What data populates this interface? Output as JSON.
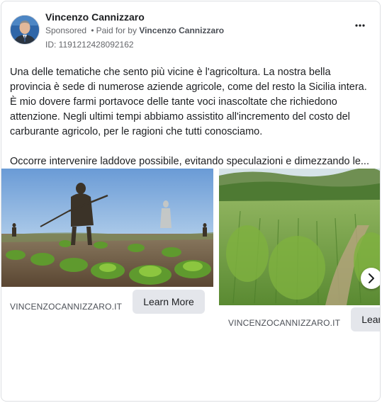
{
  "post": {
    "author_name": "Vincenzo Cannizzaro",
    "sponsored_label": "Sponsored",
    "separator": "•",
    "paid_for_prefix": "Paid for by",
    "paid_for_name": "Vincenzo Cannizzaro",
    "ad_id": "ID: 1191212428092162",
    "more_icon": "more-horizontal-icon",
    "paragraph_1": "Una delle tematiche che sento più vicine è l'agricoltura. La nostra bella provincia è sede di numerose aziende agricole, come del resto la Sicilia intera. È mio dovere farmi portavoce delle tante voci inascoltate che richiedono attenzione. Negli ultimi tempi abbiamo assistito all'incremento del costo del carburante agricolo, per le ragioni che tutti conosciamo.",
    "paragraph_2": "Occorre intervenire laddove possibile, evitando speculazioni e dimezzando le..."
  },
  "carousel": {
    "cards": [
      {
        "domain": "VINCENZOCANNIZZARO.IT",
        "cta_label": "Learn More"
      },
      {
        "domain": "VINCENZOCANNIZZARO.IT",
        "cta_label": "Learn More"
      }
    ],
    "next_icon": "chevron-right-icon"
  },
  "colors": {
    "cta_bg": "#e4e6eb",
    "secondary_text": "#65676b",
    "avatar_bg": "#2a5c9a"
  }
}
